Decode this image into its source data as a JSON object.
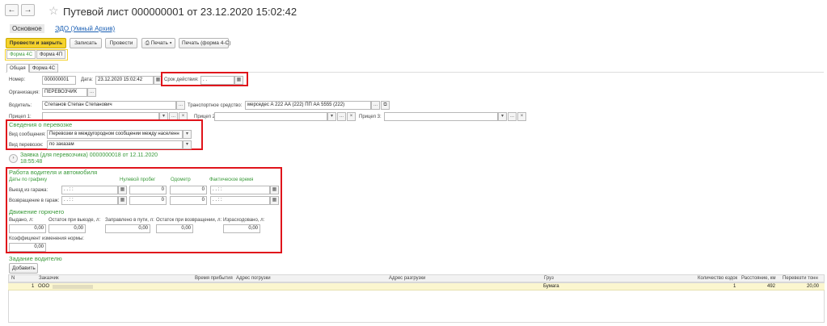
{
  "nav": {
    "back": "←",
    "forward": "→"
  },
  "window": {
    "title": "Путевой лист 000000001 от 23.12.2020 15:02:42"
  },
  "tabs": [
    {
      "label": "Основное"
    },
    {
      "label": "ЭДО (Умный Архив)"
    }
  ],
  "toolbar": {
    "post_close": "Провести и закрыть",
    "save": "Записать",
    "post": "Провести",
    "print": "Печать",
    "print_form": "Печать (форма 4-С)"
  },
  "form_tabs": [
    {
      "label": "Форма 4С"
    },
    {
      "label": "Форма 4П"
    }
  ],
  "inner_tabs": [
    {
      "label": "Общая"
    },
    {
      "label": "Форма 4С"
    }
  ],
  "header": {
    "number_label": "Номер:",
    "number": "000000001",
    "date_label": "Дата:",
    "date": "23.12.2020 15:02:42",
    "validity_label": "Срок действия:",
    "validity": ". .",
    "org_label": "Организация:",
    "org": "ПЕРЕВОЗЧИК",
    "driver_label": "Водитель:",
    "driver": "Степанов Степан Степанович",
    "vehicle_label": "Транспортное средство:",
    "vehicle": "мерседес А 222 АА (222) ПП АА 5555 (222)",
    "trailer1_label": "Прицеп 1:",
    "trailer2_label": "Прицеп 2:",
    "trailer3_label": "Прицеп 3:"
  },
  "transport": {
    "section_title": "Сведения о перевозке",
    "message_label": "Вид сообщения:",
    "message": "Перевозки в междугородном сообщении между населенн",
    "kind_label": "Вид перевозок:",
    "kind": "по заказам"
  },
  "request": {
    "title": "Заявка (для перевозчика) 0000000018 от 12.11.2020",
    "time": "18:55:48"
  },
  "work": {
    "section_title": "Работа водителя и автомобиля",
    "schedule_label": "Даты по графику",
    "zero_run_label": "Нулевой пробег",
    "odometer_label": "Одометр",
    "actual_label": "Фактическое время",
    "depart_label": "Выезд из гаража:",
    "depart_date": ". .  :  :",
    "return_label": "Возвращение в гараж:",
    "return_date": ". .  :  :",
    "zero_depart": "0",
    "odo_depart": "0",
    "zero_return": "0",
    "odo_return": "0",
    "actual_depart": ". .  :  :",
    "actual_return": ". .  :  :"
  },
  "fuel": {
    "section_title": "Движение горючего",
    "issued_label": "Выдано, л:",
    "issued": "0,00",
    "left_depart_label": "Остаток при выезде, л:",
    "left_depart": "0,00",
    "refuel_label": "Заправлено в пути, л:",
    "refuel": "0,00",
    "left_return_label": "Остаток при возвращении, л:",
    "left_return": "0,00",
    "used_label": "Израсходовано, л:",
    "used": "0,00",
    "coef_label": "Коэффициент изменения нормы:",
    "coef": "0,00"
  },
  "task": {
    "section_title": "Задание водителю",
    "add": "Добавить"
  },
  "grid": {
    "columns": [
      "N",
      "Заказчик",
      "Время прибытия",
      "Адрес погрузки",
      "Адрес разгрузки",
      "Груз",
      "Количество ездок",
      "Расстояние, км",
      "Перевезти тонн"
    ],
    "rows": [
      {
        "n": "1",
        "customer": "ООО",
        "arrival": "",
        "load": "",
        "unload": "",
        "cargo": "Бумага",
        "trips": "1",
        "distance": "492",
        "tons": "20,00"
      }
    ]
  },
  "colors": {
    "accent": "#f5d22b",
    "section_green": "#3a9a3a",
    "highlight": "#e0141b"
  }
}
